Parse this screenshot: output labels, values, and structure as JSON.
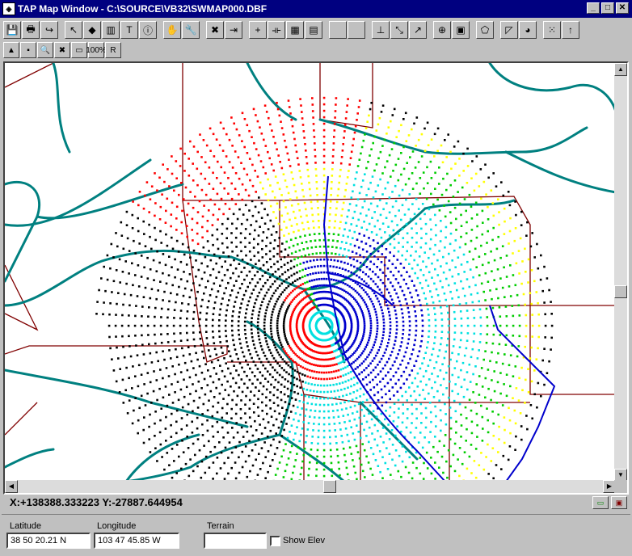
{
  "window": {
    "title": "TAP Map Window - C:\\SOURCE\\VB32\\SWMAP000.DBF"
  },
  "window_buttons": [
    {
      "name": "minimize-button",
      "glyph": "_"
    },
    {
      "name": "maximize-button",
      "glyph": "□"
    },
    {
      "name": "close-button",
      "glyph": "✕"
    }
  ],
  "toolbar1": [
    {
      "name": "save-icon",
      "glyph": "💾"
    },
    {
      "name": "print-icon",
      "glyph": "🖶"
    },
    {
      "name": "redo-arrow-icon",
      "glyph": "↪"
    },
    {
      "sep": true
    },
    {
      "name": "select-arrow-icon",
      "glyph": "↖"
    },
    {
      "name": "shapes-icon",
      "glyph": "◆"
    },
    {
      "name": "building-icon",
      "glyph": "▥"
    },
    {
      "name": "text-tool-icon",
      "glyph": "T"
    },
    {
      "name": "info-icon",
      "glyph": "ⓘ"
    },
    {
      "sep": true
    },
    {
      "name": "drag-hand-icon",
      "glyph": "✋"
    },
    {
      "name": "wrench-icon",
      "glyph": "🔧"
    },
    {
      "sep": true
    },
    {
      "name": "delete-x-icon",
      "glyph": "✖"
    },
    {
      "name": "exit-door-icon",
      "glyph": "⇥"
    },
    {
      "sep": true
    },
    {
      "name": "crosshair-plus-icon",
      "glyph": "+"
    },
    {
      "name": "ruler-icon",
      "glyph": "⟛"
    },
    {
      "name": "grid-icon",
      "glyph": "▦"
    },
    {
      "name": "notepad-icon",
      "glyph": "▤"
    },
    {
      "sep": true
    },
    {
      "name": "blank-button-1-icon",
      "glyph": ""
    },
    {
      "name": "blank-button-2-icon",
      "glyph": ""
    },
    {
      "sep": true
    },
    {
      "name": "axis-icon",
      "glyph": "⊥"
    },
    {
      "name": "zoom-box-icon",
      "glyph": "⤡"
    },
    {
      "name": "expand-arrow-icon",
      "glyph": "↗"
    },
    {
      "sep": true
    },
    {
      "name": "target-crosshair-icon",
      "glyph": "⊕"
    },
    {
      "name": "color-layers-icon",
      "glyph": "▣"
    },
    {
      "sep": true
    },
    {
      "name": "polygon-icon",
      "glyph": "⬠"
    },
    {
      "sep": true
    },
    {
      "name": "terrain-profile-icon",
      "glyph": "◸"
    },
    {
      "name": "pie-chart-icon",
      "glyph": "◕"
    },
    {
      "sep": true
    },
    {
      "name": "scatter-points-icon",
      "glyph": "⁙"
    },
    {
      "name": "up-arrow-icon",
      "glyph": "↑"
    }
  ],
  "toolbar2": [
    {
      "name": "tower-green-icon",
      "glyph": "▲"
    },
    {
      "name": "tower-small-icon",
      "glyph": "▪"
    },
    {
      "name": "magnify-globe-icon",
      "glyph": "🔍"
    },
    {
      "name": "red-x-icon",
      "glyph": "✖"
    },
    {
      "name": "map-frame-icon",
      "glyph": "▭"
    },
    {
      "name": "zoom-100-icon",
      "glyph": "100%"
    },
    {
      "name": "r-label-icon",
      "glyph": "R"
    }
  ],
  "status": {
    "coordinates": "X:+138388.333223 Y:-27887.644954"
  },
  "fields": {
    "latitude_label": "Latitude",
    "latitude_value": "38 50 20.21 N",
    "longitude_label": "Longitude",
    "longitude_value": "103 47 45.85 W",
    "terrain_label": "Terrain",
    "terrain_value": "",
    "show_elev_label": "Show Elev"
  },
  "map": {
    "colors": {
      "county_border": "#800000",
      "road": "#008080",
      "coverage_outline": "#0000cc",
      "signal_levels": [
        "#000000",
        "#ff0000",
        "#ffff00",
        "#00cc00",
        "#00e0e0",
        "#0000cc"
      ]
    }
  }
}
